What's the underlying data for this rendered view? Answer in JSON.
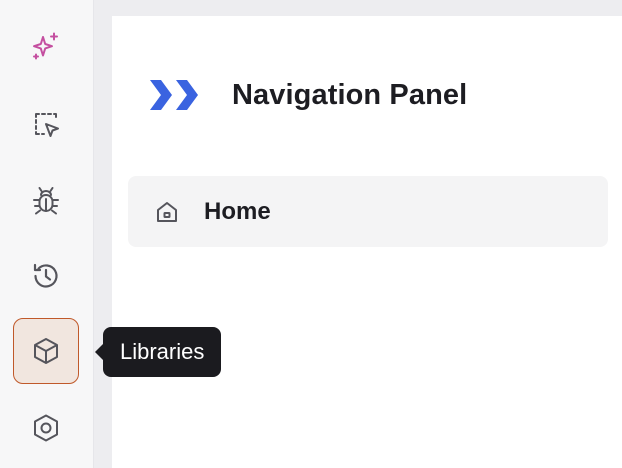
{
  "sidebar": {
    "items": [
      {
        "icon": "sparkles-icon",
        "color": "#c44fa0"
      },
      {
        "icon": "select-pointer-icon",
        "color": "#55555c"
      },
      {
        "icon": "bug-icon",
        "color": "#55555c"
      },
      {
        "icon": "history-icon",
        "color": "#55555c"
      },
      {
        "icon": "cube-icon",
        "color": "#55555c",
        "active": true
      },
      {
        "icon": "hexagon-settings-icon",
        "color": "#55555c"
      }
    ],
    "active_border_color": "#c0592a",
    "active_bg_color": "#f1e6df"
  },
  "tooltip": {
    "label": "Libraries"
  },
  "panel": {
    "title": "Navigation Panel",
    "logo_color": "#3a63e0",
    "nav": [
      {
        "label": "Home",
        "icon": "home-icon"
      }
    ]
  }
}
